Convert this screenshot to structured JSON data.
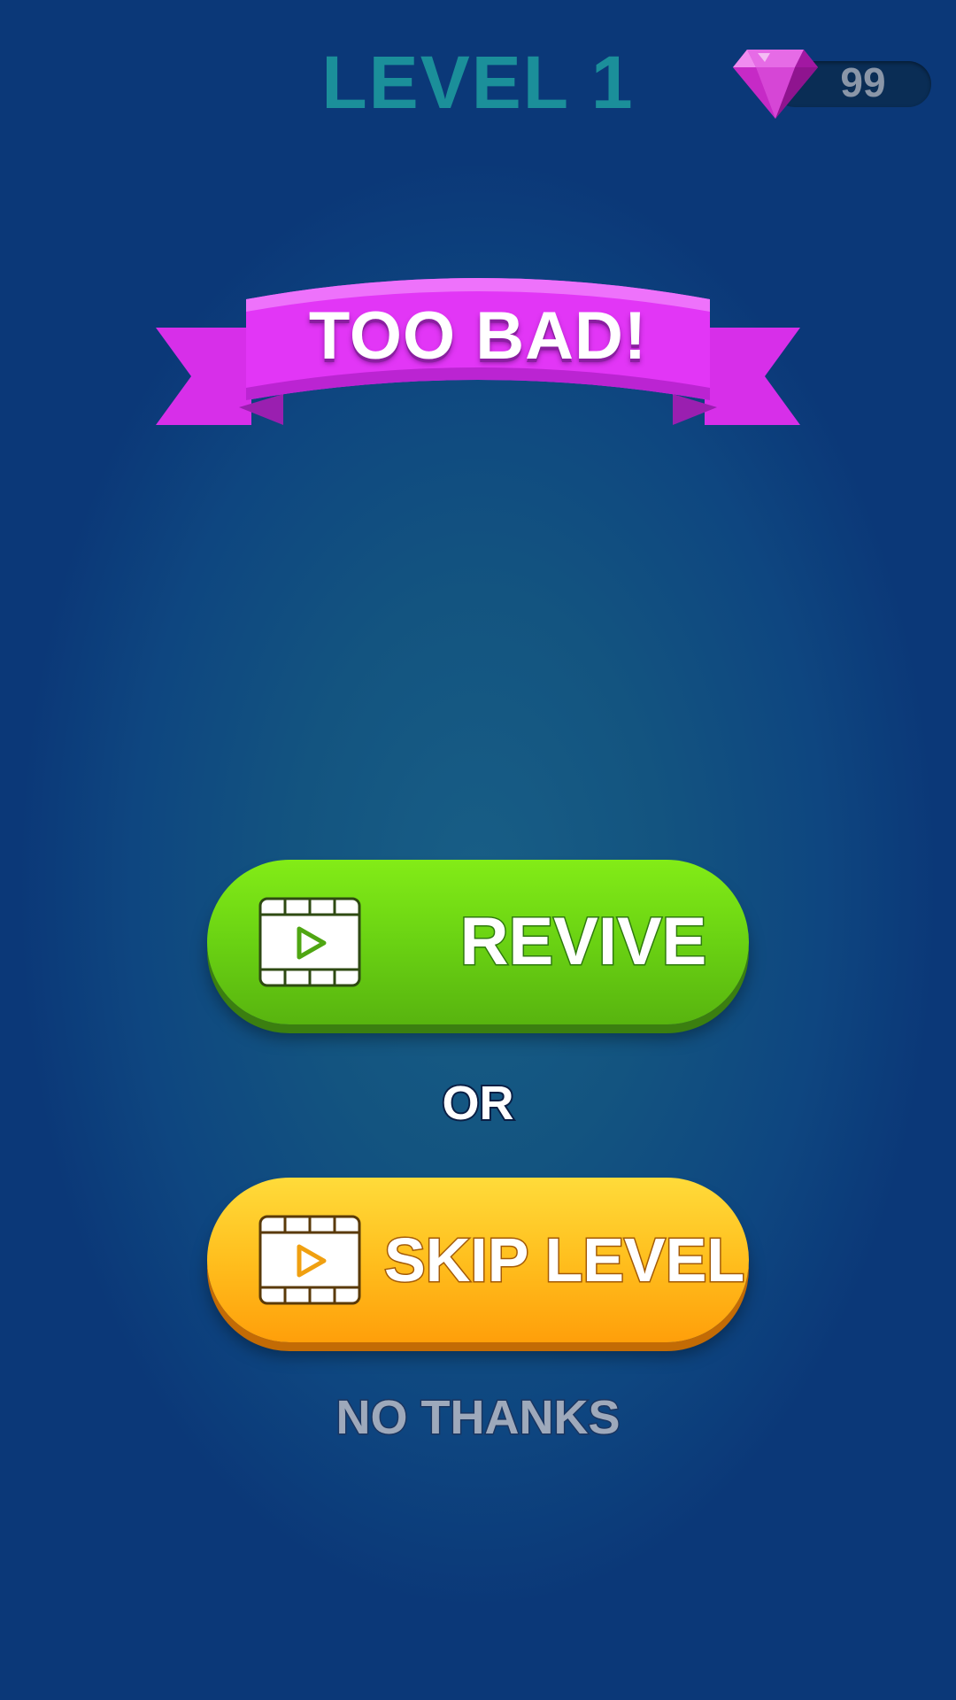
{
  "header": {
    "level_title": "LEVEL 1",
    "gem_count": "99"
  },
  "banner": {
    "text": "TOO BAD!"
  },
  "actions": {
    "revive_label": "REVIVE",
    "or_label": "OR",
    "skip_label": "SKIP LEVEL",
    "no_thanks_label": "NO THANKS"
  },
  "icons": {
    "gem": "gem-icon",
    "video": "video-play-icon"
  },
  "colors": {
    "level_title": "#1b8f9a",
    "ribbon": "#e233f4",
    "revive_button": "#6ad213",
    "skip_button": "#ffbf1e",
    "background": "#0e4680"
  }
}
